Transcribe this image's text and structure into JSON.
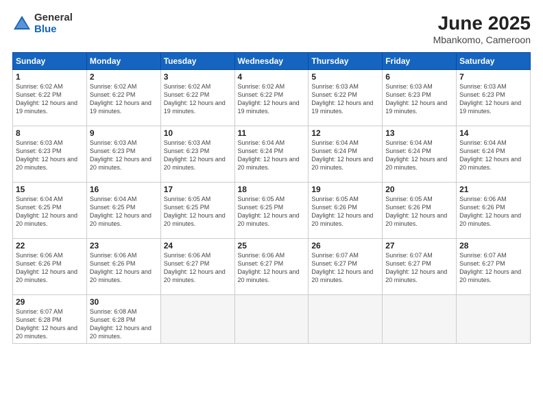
{
  "header": {
    "logo_general": "General",
    "logo_blue": "Blue",
    "month_year": "June 2025",
    "location": "Mbankomo, Cameroon"
  },
  "days_of_week": [
    "Sunday",
    "Monday",
    "Tuesday",
    "Wednesday",
    "Thursday",
    "Friday",
    "Saturday"
  ],
  "weeks": [
    [
      {
        "day": "1",
        "sunrise": "6:02 AM",
        "sunset": "6:22 PM",
        "daylight": "12 hours and 19 minutes."
      },
      {
        "day": "2",
        "sunrise": "6:02 AM",
        "sunset": "6:22 PM",
        "daylight": "12 hours and 19 minutes."
      },
      {
        "day": "3",
        "sunrise": "6:02 AM",
        "sunset": "6:22 PM",
        "daylight": "12 hours and 19 minutes."
      },
      {
        "day": "4",
        "sunrise": "6:02 AM",
        "sunset": "6:22 PM",
        "daylight": "12 hours and 19 minutes."
      },
      {
        "day": "5",
        "sunrise": "6:03 AM",
        "sunset": "6:22 PM",
        "daylight": "12 hours and 19 minutes."
      },
      {
        "day": "6",
        "sunrise": "6:03 AM",
        "sunset": "6:23 PM",
        "daylight": "12 hours and 19 minutes."
      },
      {
        "day": "7",
        "sunrise": "6:03 AM",
        "sunset": "6:23 PM",
        "daylight": "12 hours and 19 minutes."
      }
    ],
    [
      {
        "day": "8",
        "sunrise": "6:03 AM",
        "sunset": "6:23 PM",
        "daylight": "12 hours and 20 minutes."
      },
      {
        "day": "9",
        "sunrise": "6:03 AM",
        "sunset": "6:23 PM",
        "daylight": "12 hours and 20 minutes."
      },
      {
        "day": "10",
        "sunrise": "6:03 AM",
        "sunset": "6:23 PM",
        "daylight": "12 hours and 20 minutes."
      },
      {
        "day": "11",
        "sunrise": "6:04 AM",
        "sunset": "6:24 PM",
        "daylight": "12 hours and 20 minutes."
      },
      {
        "day": "12",
        "sunrise": "6:04 AM",
        "sunset": "6:24 PM",
        "daylight": "12 hours and 20 minutes."
      },
      {
        "day": "13",
        "sunrise": "6:04 AM",
        "sunset": "6:24 PM",
        "daylight": "12 hours and 20 minutes."
      },
      {
        "day": "14",
        "sunrise": "6:04 AM",
        "sunset": "6:24 PM",
        "daylight": "12 hours and 20 minutes."
      }
    ],
    [
      {
        "day": "15",
        "sunrise": "6:04 AM",
        "sunset": "6:25 PM",
        "daylight": "12 hours and 20 minutes."
      },
      {
        "day": "16",
        "sunrise": "6:04 AM",
        "sunset": "6:25 PM",
        "daylight": "12 hours and 20 minutes."
      },
      {
        "day": "17",
        "sunrise": "6:05 AM",
        "sunset": "6:25 PM",
        "daylight": "12 hours and 20 minutes."
      },
      {
        "day": "18",
        "sunrise": "6:05 AM",
        "sunset": "6:25 PM",
        "daylight": "12 hours and 20 minutes."
      },
      {
        "day": "19",
        "sunrise": "6:05 AM",
        "sunset": "6:26 PM",
        "daylight": "12 hours and 20 minutes."
      },
      {
        "day": "20",
        "sunrise": "6:05 AM",
        "sunset": "6:26 PM",
        "daylight": "12 hours and 20 minutes."
      },
      {
        "day": "21",
        "sunrise": "6:06 AM",
        "sunset": "6:26 PM",
        "daylight": "12 hours and 20 minutes."
      }
    ],
    [
      {
        "day": "22",
        "sunrise": "6:06 AM",
        "sunset": "6:26 PM",
        "daylight": "12 hours and 20 minutes."
      },
      {
        "day": "23",
        "sunrise": "6:06 AM",
        "sunset": "6:26 PM",
        "daylight": "12 hours and 20 minutes."
      },
      {
        "day": "24",
        "sunrise": "6:06 AM",
        "sunset": "6:27 PM",
        "daylight": "12 hours and 20 minutes."
      },
      {
        "day": "25",
        "sunrise": "6:06 AM",
        "sunset": "6:27 PM",
        "daylight": "12 hours and 20 minutes."
      },
      {
        "day": "26",
        "sunrise": "6:07 AM",
        "sunset": "6:27 PM",
        "daylight": "12 hours and 20 minutes."
      },
      {
        "day": "27",
        "sunrise": "6:07 AM",
        "sunset": "6:27 PM",
        "daylight": "12 hours and 20 minutes."
      },
      {
        "day": "28",
        "sunrise": "6:07 AM",
        "sunset": "6:27 PM",
        "daylight": "12 hours and 20 minutes."
      }
    ],
    [
      {
        "day": "29",
        "sunrise": "6:07 AM",
        "sunset": "6:28 PM",
        "daylight": "12 hours and 20 minutes."
      },
      {
        "day": "30",
        "sunrise": "6:08 AM",
        "sunset": "6:28 PM",
        "daylight": "12 hours and 20 minutes."
      },
      null,
      null,
      null,
      null,
      null
    ]
  ]
}
